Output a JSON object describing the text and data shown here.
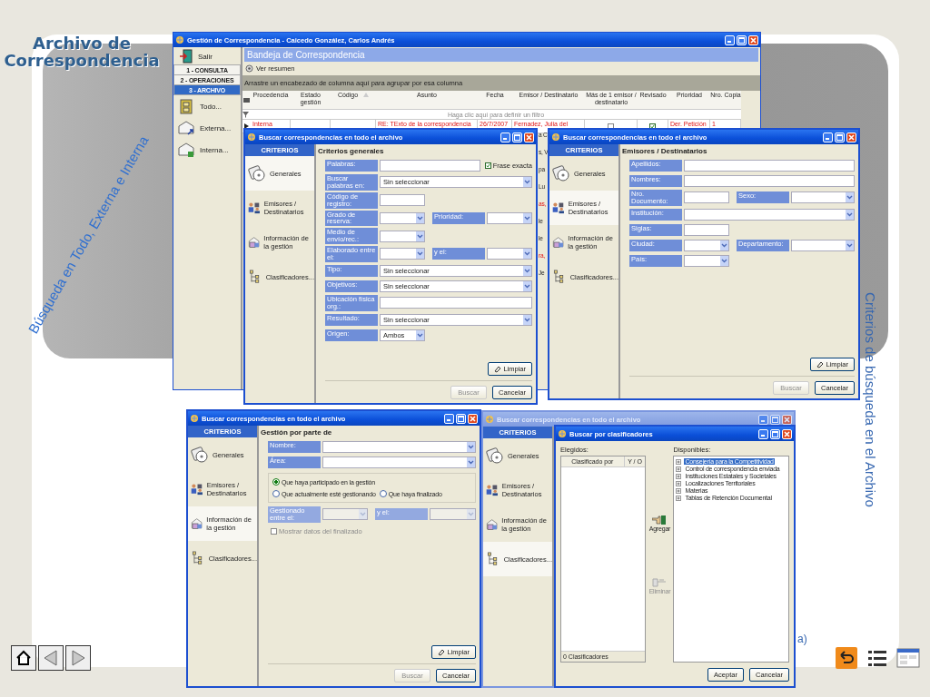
{
  "slide": {
    "title": "Archivo de Correspondencia",
    "side_caption": "Búsqueda en Todo, Externa e Interna",
    "right_caption": "Criterios de búsqueda en el Archivo",
    "fragment": "a)"
  },
  "main_window": {
    "title": "Gestión de Correspondencia - Caicedo González, Carlos Andrés",
    "exit": "Salir",
    "sections": [
      {
        "label": "1 - CONSULTA",
        "selected": false
      },
      {
        "label": "2 - OPERACIONES",
        "selected": false
      },
      {
        "label": "3 - ARCHIVO",
        "selected": true
      }
    ],
    "items": [
      "Todo...",
      "Externa...",
      "Interna..."
    ],
    "header": "Bandeja de Correspondencia",
    "summary": "Ver resumen",
    "group_hint": "Arrastre un encabezado de columna aquí para agrupar por esa columna",
    "columns": [
      "Procedencia",
      "Estado gestión",
      "Código",
      "Asunto",
      "Fecha",
      "Emisor / Destinatario",
      "Más de 1 emisor / destinatario",
      "Revisado",
      "Prioridad",
      "Nro. Copia"
    ],
    "filter_hint": "Haga clic aquí para definir un filtro",
    "rows": [
      {
        "highlighted": true,
        "cells": [
          "Interna",
          null,
          null,
          "RE: TExto de la correspondencia",
          "26/7/2007",
          "Fernadez, Julia del",
          false,
          true,
          "Der. Petición",
          "1"
        ]
      }
    ],
    "partly_covered_cells": [
      {
        "text": "a C",
        "highlighted": false
      },
      {
        "text": "s, V",
        "highlighted": false
      },
      {
        "text": "pa",
        "highlighted": false
      },
      {
        "text": "Lu",
        "highlighted": false
      },
      {
        "text": "as,",
        "highlighted": true
      },
      {
        "text": "le",
        "highlighted": false
      },
      {
        "text": "le",
        "highlighted": false
      },
      {
        "text": "ra,",
        "highlighted": true
      },
      {
        "text": "Je",
        "highlighted": false
      }
    ]
  },
  "dialogs": [
    {
      "title": "Buscar correspondencias en todo el archivo",
      "active": true,
      "criteria_header": "CRITERIOS",
      "criteria": [
        {
          "label": "Generales",
          "selected": true
        },
        {
          "label": "Emisores / Destinatarios",
          "selected": false
        },
        {
          "label": "Información de la gestión",
          "selected": false
        },
        {
          "label": "Clasificadores...",
          "selected": false
        }
      ],
      "section": "Criterios generales",
      "rows": [
        {
          "kind": "fields",
          "fields": [
            {
              "label": "Palabras:",
              "kind": "text"
            }
          ],
          "check": {
            "label": "Frase exacta",
            "checked": true
          }
        },
        {
          "kind": "fields",
          "fields": [
            {
              "label": "Buscar palabras en:",
              "kind": "combo",
              "value": "Sin seleccionar"
            }
          ]
        },
        {
          "kind": "fields",
          "fields": [
            {
              "label": "Código de registro:",
              "kind": "short-text"
            }
          ]
        },
        {
          "kind": "fields",
          "fields": [
            {
              "label": "Grado de reserva:",
              "kind": "short-combo"
            },
            {
              "label": "Prioridad:",
              "kind": "combo"
            }
          ]
        },
        {
          "kind": "fields",
          "fields": [
            {
              "label": "Medio de envío/rec.:",
              "kind": "short-combo"
            }
          ]
        },
        {
          "kind": "fields",
          "fields": [
            {
              "label": "Elaborado entre el:",
              "kind": "short-combo"
            },
            {
              "label": "y el:",
              "kind": "combo"
            }
          ]
        },
        {
          "kind": "fields",
          "fields": [
            {
              "label": "Tipo:",
              "kind": "combo",
              "value": "Sin seleccionar"
            }
          ]
        },
        {
          "kind": "fields",
          "fields": [
            {
              "label": "Objetivos:",
              "kind": "combo",
              "value": "Sin seleccionar"
            }
          ]
        },
        {
          "kind": "fields",
          "fields": [
            {
              "label": "Ubicación física org.:",
              "kind": "text"
            }
          ]
        },
        {
          "kind": "fields",
          "fields": [
            {
              "label": "Resultado:",
              "kind": "combo",
              "value": "Sin seleccionar"
            }
          ]
        },
        {
          "kind": "fields",
          "fields": [
            {
              "label": "Origen:",
              "kind": "short-combo",
              "value": "Ambos"
            }
          ]
        }
      ],
      "clear": "Limpiar",
      "search": "Buscar",
      "search_disabled": true,
      "cancel": "Cancelar"
    },
    {
      "title": "Buscar correspondencias en todo el archivo",
      "active": true,
      "criteria_header": "CRITERIOS",
      "criteria": [
        {
          "label": "Generales",
          "selected": false
        },
        {
          "label": "Emisores / Destinatarios",
          "selected": true
        },
        {
          "label": "Información de la gestión",
          "selected": false
        },
        {
          "label": "Clasificadores...",
          "selected": false
        }
      ],
      "section": "Emisores / Destinatarios",
      "rows": [
        {
          "kind": "fields",
          "fields": [
            {
              "label": "Apellidos:",
              "kind": "text"
            }
          ]
        },
        {
          "kind": "fields",
          "fields": [
            {
              "label": "Nombres:",
              "kind": "text"
            }
          ]
        },
        {
          "kind": "fields",
          "fields": [
            {
              "label": "Nro. Documento:",
              "kind": "short-text"
            },
            {
              "label": "Sexo:",
              "kind": "combo"
            }
          ]
        },
        {
          "kind": "fields",
          "fields": [
            {
              "label": "Institución:",
              "kind": "combo"
            }
          ]
        },
        {
          "kind": "fields",
          "fields": [
            {
              "label": "Siglas:",
              "kind": "short-text"
            }
          ]
        },
        {
          "kind": "fields",
          "fields": [
            {
              "label": "Ciudad:",
              "kind": "short-combo"
            },
            {
              "label": "Departamento:",
              "kind": "combo"
            }
          ]
        },
        {
          "kind": "fields",
          "fields": [
            {
              "label": "País:",
              "kind": "short-combo"
            }
          ]
        }
      ],
      "clear": "Limpiar",
      "search": "Buscar",
      "search_disabled": true,
      "cancel": "Cancelar"
    },
    {
      "title": "Buscar correspondencias en todo el archivo",
      "active": true,
      "criteria_header": "CRITERIOS",
      "criteria": [
        {
          "label": "Generales",
          "selected": false
        },
        {
          "label": "Emisores / Destinatarios",
          "selected": false
        },
        {
          "label": "Información de la gestión",
          "selected": true
        },
        {
          "label": "Clasificadores...",
          "selected": false
        }
      ],
      "section": "Gestión por parte de",
      "rows": [
        {
          "kind": "fields",
          "fields": [
            {
              "label": "Nombre:",
              "kind": "combo",
              "disabled": false
            }
          ]
        },
        {
          "kind": "fields",
          "fields": [
            {
              "label": "Área:",
              "kind": "combo",
              "disabled": false
            }
          ]
        },
        {
          "kind": "radios",
          "options": [
            {
              "label": "Que haya participado en la gestión",
              "selected": true
            },
            {
              "label": "Que actualmente esté gestionando",
              "selected": false
            },
            {
              "label": "Que haya finalizado",
              "selected": false
            }
          ]
        },
        {
          "kind": "fields",
          "fields": [
            {
              "label": "Gestionado entre el:",
              "kind": "short-combo",
              "disabled": true
            },
            {
              "label": "y el:",
              "kind": "combo",
              "disabled": true
            }
          ]
        },
        {
          "kind": "check",
          "label": "Mostrar datos del finalizado",
          "checked": false,
          "disabled": true
        }
      ],
      "clear": "Limpiar",
      "search": "Buscar",
      "search_disabled": true,
      "cancel": "Cancelar"
    },
    {
      "title": "Buscar correspondencias en todo el archivo",
      "active": false,
      "criteria_header": "CRITERIOS",
      "criteria": [
        {
          "label": "Generales",
          "selected": false
        },
        {
          "label": "Emisores / Destinatarios",
          "selected": false
        },
        {
          "label": "Información de la gestión",
          "selected": false
        },
        {
          "label": "Clasificadores...",
          "selected": true
        }
      ]
    }
  ],
  "classifier_dialog": {
    "title": "Buscar por clasificadores",
    "chosen_label": "Elegidos:",
    "columns": [
      "Clasificado por",
      "Y / O"
    ],
    "count": "0 Clasificadores",
    "add": "Agregar",
    "remove": "Eliminar",
    "remove_disabled": true,
    "available_label": "Disponibles:",
    "tree": [
      {
        "label": "Consejería para la Competitividad",
        "selected": true
      },
      {
        "label": "Control de correspondencia enviada",
        "selected": false
      },
      {
        "label": "Instituciones  Estatales y Societales",
        "selected": false
      },
      {
        "label": "Localizaciones Territoriales",
        "selected": false
      },
      {
        "label": "Materias",
        "selected": false
      },
      {
        "label": "Tablas de Retención Documental",
        "selected": false
      }
    ],
    "ok": "Aceptar",
    "cancel": "Cancelar"
  }
}
